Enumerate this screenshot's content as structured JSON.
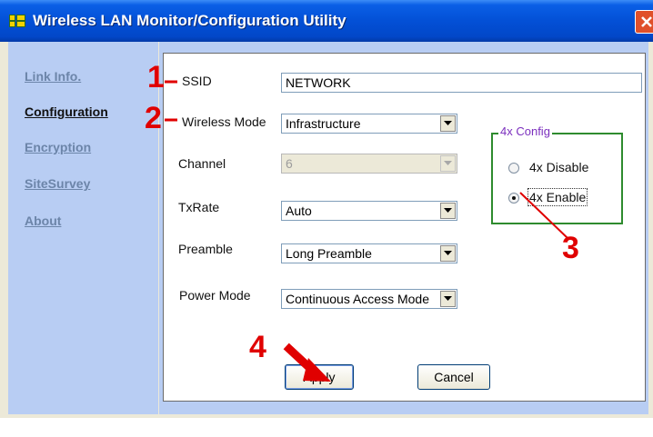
{
  "window": {
    "title": "Wireless LAN Monitor/Configuration Utility"
  },
  "nav": [
    {
      "label": "Link Info."
    },
    {
      "label": "Configuration"
    },
    {
      "label": "Encryption"
    },
    {
      "label": "SiteSurvey"
    },
    {
      "label": "About"
    }
  ],
  "form": {
    "ssid": {
      "label": "SSID",
      "value": "NETWORK"
    },
    "wireless_mode": {
      "label": "Wireless Mode",
      "value": "Infrastructure"
    },
    "channel": {
      "label": "Channel",
      "value": "6"
    },
    "txrate": {
      "label": "TxRate",
      "value": "Auto"
    },
    "preamble": {
      "label": "Preamble",
      "value": "Long Preamble"
    },
    "power_mode": {
      "label": "Power Mode",
      "value": "Continuous Access Mode"
    }
  },
  "config4x": {
    "title": "4x Config",
    "options": [
      {
        "label": "4x Disable",
        "checked": false
      },
      {
        "label": "4x Enable",
        "checked": true
      }
    ]
  },
  "buttons": {
    "apply": "Apply",
    "cancel": "Cancel"
  },
  "annotations": {
    "m1": "1",
    "m2": "2",
    "m3": "3",
    "m4": "4",
    "color": "#e00000"
  },
  "colors": {
    "titlebar": "#0350d6",
    "sidebar": "#b8cdf3",
    "groupbox_border": "#2e8b2e",
    "group_title": "#7b2fbe"
  }
}
